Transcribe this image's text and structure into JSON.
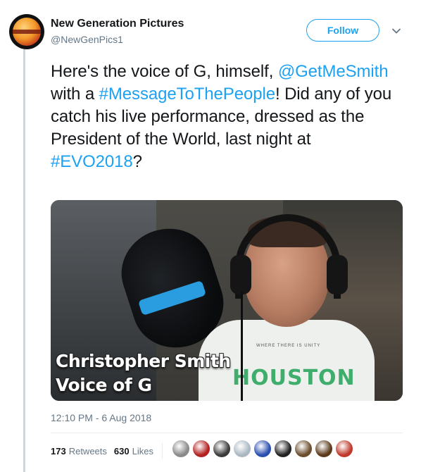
{
  "author": {
    "name": "New Generation Pictures",
    "handle": "@NewGenPics1",
    "avatar_icon": "orange-burger-logo"
  },
  "actions": {
    "follow_label": "Follow",
    "caret_icon": "chevron-down-icon"
  },
  "tweet": {
    "segments": {
      "s1": "Here's the voice of G, himself, ",
      "mention": "@GetMeSmith",
      "s2": " with a ",
      "hashtag1": "#MessageToThePeople",
      "s3": "! Did any of you catch his live performance, dressed as the President of the World, last night at ",
      "hashtag2": "#EVO2018",
      "s4": "?"
    }
  },
  "media": {
    "caption_line1": "Christopher Smith",
    "caption_line2": "Voice of G",
    "shirt_logo": "HOUSTON",
    "shirt_small_text": "WHERE THERE IS UNITY"
  },
  "meta": {
    "timestamp": "12:10 PM - 6 Aug 2018"
  },
  "stats": {
    "retweets_count": "173",
    "retweets_label": "Retweets",
    "likes_count": "630",
    "likes_label": "Likes"
  },
  "colors": {
    "link": "#1da1f2",
    "secondary": "#657786",
    "text": "#14171a",
    "border": "#e6ecf0"
  },
  "likers": [
    {
      "name": "liker-avatar-1",
      "color": "#8a8a8a"
    },
    {
      "name": "liker-avatar-2",
      "color": "#b22020"
    },
    {
      "name": "liker-avatar-3",
      "color": "#3b3b3b"
    },
    {
      "name": "liker-avatar-4",
      "color": "#aab8c2"
    },
    {
      "name": "liker-avatar-5",
      "color": "#2a4fb0"
    },
    {
      "name": "liker-avatar-6",
      "color": "#222222"
    },
    {
      "name": "liker-avatar-7",
      "color": "#6b4e2e"
    },
    {
      "name": "liker-avatar-8",
      "color": "#5a3a1a"
    },
    {
      "name": "liker-avatar-9",
      "color": "#c0392b"
    }
  ]
}
